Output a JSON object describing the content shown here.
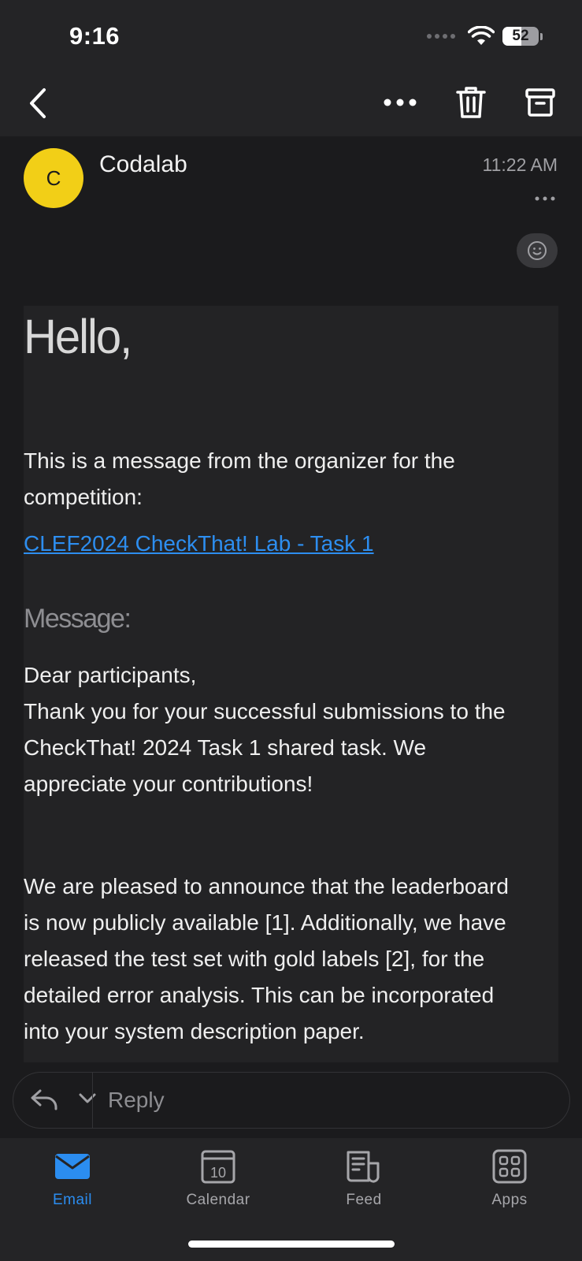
{
  "status_bar": {
    "time": "9:16",
    "battery_level": "52",
    "battery_percent": 52
  },
  "header": {
    "back_icon": "chevron-left-icon",
    "more_icon": "more-horizontal-icon",
    "delete_icon": "trash-icon",
    "archive_icon": "archive-icon"
  },
  "message": {
    "avatar_initial": "C",
    "avatar_color": "#f2cf17",
    "sender": "Codalab",
    "time": "11:22 AM"
  },
  "body": {
    "greeting": "Hello,",
    "intro_line1": "This is a message from the organizer for the",
    "intro_line2": "competition:",
    "competition_link": "CLEF2024 CheckThat! Lab - Task 1",
    "message_label": "Message:",
    "para1_line1": "Dear participants,",
    "para1_line2": "Thank you for your successful submissions to the",
    "para1_line3": "CheckThat! 2024 Task 1 shared task. We",
    "para1_line4": "appreciate your contributions!",
    "para2_line1": "We are pleased to announce that the leaderboard",
    "para2_line2": "is now publicly available [1]. Additionally, we have",
    "para2_line3": "released the test set with gold labels [2], for the",
    "para2_line4": "detailed error analysis. This can be incorporated",
    "para2_line5": "into your system description paper."
  },
  "reply": {
    "placeholder": "Reply"
  },
  "tabs": [
    {
      "label": "Email",
      "icon": "envelope-icon",
      "active": true
    },
    {
      "label": "Calendar",
      "icon": "calendar-icon",
      "day": "10",
      "active": false
    },
    {
      "label": "Feed",
      "icon": "feed-icon",
      "active": false
    },
    {
      "label": "Apps",
      "icon": "apps-grid-icon",
      "active": false
    }
  ],
  "colors": {
    "accent": "#2b8df0",
    "link": "#2d8ef0",
    "background": "#1b1b1d"
  }
}
